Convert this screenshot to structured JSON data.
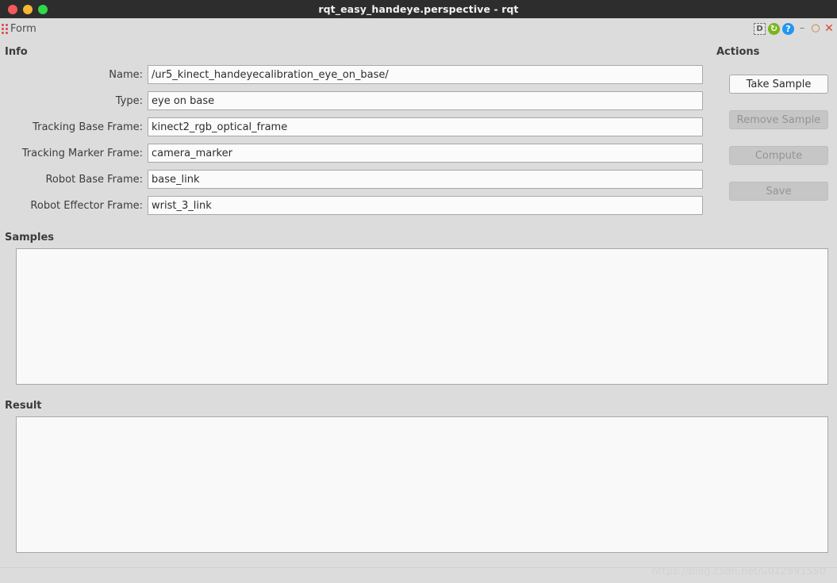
{
  "window": {
    "title": "rqt_easy_handeye.perspective - rqt",
    "traffic_lights": [
      "close-dot",
      "minimize-dot",
      "maximize-dot"
    ]
  },
  "plugin_bar": {
    "grip_icon": "drag-grip-icon",
    "label": "Form",
    "icons": [
      {
        "name": "dock-icon",
        "glyph": "D"
      },
      {
        "name": "reload-icon",
        "glyph": "↻"
      },
      {
        "name": "help-icon",
        "glyph": "?"
      }
    ],
    "window_buttons": [
      {
        "name": "minimize-button",
        "glyph": "–"
      },
      {
        "name": "maximize-button",
        "glyph": "○"
      },
      {
        "name": "close-button",
        "glyph": "✕"
      }
    ]
  },
  "info": {
    "heading": "Info",
    "fields": [
      {
        "label": "Name:",
        "value": "/ur5_kinect_handeyecalibration_eye_on_base/"
      },
      {
        "label": "Type:",
        "value": "eye on base"
      },
      {
        "label": "Tracking Base Frame:",
        "value": "kinect2_rgb_optical_frame"
      },
      {
        "label": "Tracking Marker Frame:",
        "value": "camera_marker"
      },
      {
        "label": "Robot Base Frame:",
        "value": "base_link"
      },
      {
        "label": "Robot Effector Frame:",
        "value": "wrist_3_link"
      }
    ]
  },
  "actions": {
    "heading": "Actions",
    "buttons": [
      {
        "label": "Take Sample",
        "enabled": true
      },
      {
        "label": "Remove Sample",
        "enabled": false
      },
      {
        "label": "Compute",
        "enabled": false
      },
      {
        "label": "Save",
        "enabled": false
      }
    ]
  },
  "samples": {
    "heading": "Samples",
    "content": ""
  },
  "result": {
    "heading": "Result",
    "content": ""
  },
  "watermark": {
    "text": "https://blog.csdn.net/u012891550"
  },
  "colors": {
    "background": "#dcdcdc",
    "titlebar": "#2d2d2d",
    "field_background": "#fbfbfb",
    "field_border": "#a8a8a8",
    "button_enabled": "#fafafa",
    "button_disabled": "#c6c6c6",
    "close_dot": "#f4595b",
    "minimize_dot": "#f7b733",
    "maximize_dot": "#2ed94a",
    "grip": "#e04343",
    "reload_icon": "#7ab51d",
    "help_icon": "#2196f3"
  }
}
